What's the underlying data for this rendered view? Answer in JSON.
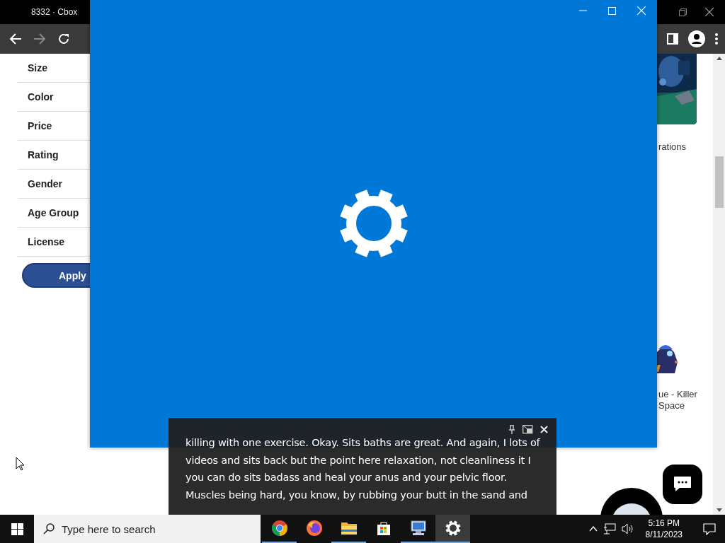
{
  "browser": {
    "tab_title": "8332 · Cbox",
    "nav_buttons": [
      {
        "kind": "back",
        "disabled": false
      },
      {
        "kind": "forward",
        "disabled": true
      },
      {
        "kind": "reload",
        "disabled": false
      }
    ],
    "filters": [
      {
        "label": "Size"
      },
      {
        "label": "Color"
      },
      {
        "label": "Price"
      },
      {
        "label": "Rating"
      },
      {
        "label": "Gender"
      },
      {
        "label": "Age Group"
      },
      {
        "label": "License"
      }
    ],
    "apply_button": "Apply",
    "products": [
      {
        "kind": "picture",
        "caption": [
          "rations"
        ]
      },
      {
        "kind": "picture",
        "caption": [
          "ue - Killer",
          "Space"
        ]
      }
    ]
  },
  "settings_window": {
    "kind": "splash"
  },
  "caption_window": {
    "text": "killing with one exercise. Okay. Sits baths are great. And again, I lots of videos and sits back but the point here relaxation, not cleanliness it I you can do sits badass and heal your anus and your pelvic floor. Muscles being hard, you know, by rubbing your butt in the sand and"
  },
  "taskbar": {
    "search": {
      "placeholder": "Type here to search"
    },
    "apps": [
      {
        "kind": "chrome",
        "running": true,
        "selected": false
      },
      {
        "kind": "firefox",
        "running": false,
        "selected": false
      },
      {
        "kind": "explorer",
        "running": true,
        "selected": false
      },
      {
        "kind": "store",
        "running": false,
        "selected": false
      },
      {
        "kind": "control",
        "running": true,
        "selected": false
      },
      {
        "kind": "settings",
        "running": true,
        "selected": true
      }
    ],
    "time": "5:16 PM",
    "date": "8/11/2023"
  }
}
